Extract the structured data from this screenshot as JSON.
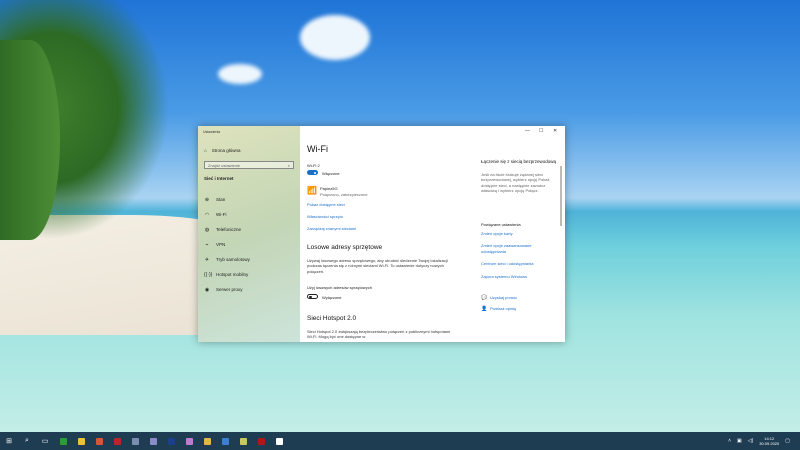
{
  "window": {
    "title": "Ustawienia",
    "controls": {
      "minimize": "—",
      "maximize": "☐",
      "close": "✕"
    }
  },
  "sidebar": {
    "home": "Strona główna",
    "search_placeholder": "Znajdź ustawienie",
    "category": "Sieć i Internet",
    "items": [
      {
        "icon": "⊕",
        "label": "Stan"
      },
      {
        "icon": "◠",
        "label": "Wi-Fi"
      },
      {
        "icon": "◍",
        "label": "Telefoniczne"
      },
      {
        "icon": "⌁",
        "label": "VPN"
      },
      {
        "icon": "✈",
        "label": "Tryb samolotowy"
      },
      {
        "icon": "((·))",
        "label": "Hotspot mobilny"
      },
      {
        "icon": "◉",
        "label": "Serwer proxy"
      }
    ],
    "active_index": 1
  },
  "main": {
    "title": "Wi-Fi",
    "adapter": "Wi-Fi 2",
    "wifi_toggle": {
      "state": "on",
      "label": "Włączone"
    },
    "network": {
      "name": "Papiez5G",
      "status": "Połączono, zabezpieczone"
    },
    "links": [
      "Pokaż dostępne sieci",
      "Właściwości sprzętu",
      "Zarządzaj znanymi sieciami"
    ],
    "random_title": "Losowe adresy sprzętowe",
    "random_desc": "Używaj losowego adresu sprzętowego, aby utrudnić śledzenie Twojej lokalizacji podczas łączenia się z różnymi sieciami Wi-Fi. To ustawienie dotyczy nowych połączeń.",
    "random_label": "Użyj losowych adresów sprzętowych",
    "random_toggle": {
      "state": "off",
      "label": "Wyłączone"
    },
    "hotspot_title": "Sieci Hotspot 2.0",
    "hotspot_desc": "Sieci Hotspot 2.0 zwiększają bezpieczeństwo połączeń z publicznymi hotspotami Wi-Fi. Mogą być one dostępne w"
  },
  "right": {
    "help_title": "Łączenie się z siecią bezprzewodową",
    "help_text": "Jeśli na liście brakuje żądanej sieci bezprzewodowej, wybierz opcję Pokaż dostępne sieci, a następnie zaznacz właściwą i wybierz opcję Połącz.",
    "related_title": "Powiązane ustawienia",
    "related_links": [
      "Zmień opcje karty",
      "Zmień opcje zaawansowane udostępniania",
      "Centrum sieci i udostępniania",
      "Zapora systemu Windows"
    ],
    "help": "Uzyskaj pomoc",
    "feedback": "Przekaż opinię"
  },
  "taskbar": {
    "time": "14:12",
    "date": "30.09.2020",
    "apps": [
      "#2a9d3a",
      "#e8c33a",
      "#d9553a",
      "#b8262c",
      "#7a8fb0",
      "#8a8cc8",
      "#1b3f8a",
      "#c27ad0",
      "#e0b84a",
      "#3a7fd0",
      "#c7c960",
      "#b01818",
      "#ffffff"
    ]
  }
}
